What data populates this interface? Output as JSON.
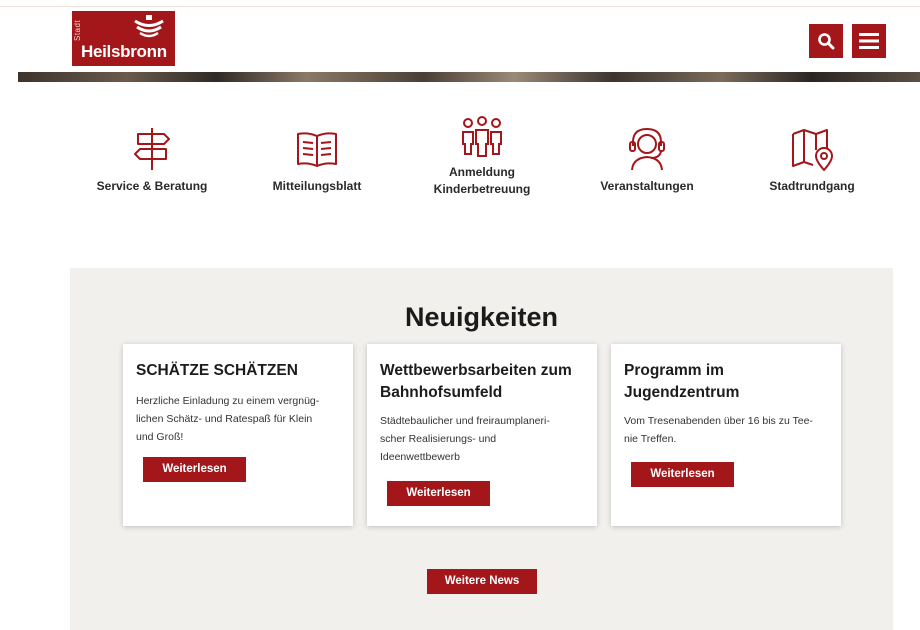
{
  "brand": {
    "prefix": "Stadt",
    "name": "Heilsbronn",
    "color": "#a3171b"
  },
  "header": {
    "search_icon": "search-icon",
    "menu_icon": "hamburger-menu-icon"
  },
  "quick_links": [
    {
      "label": "Service & Beratung",
      "icon": "signpost-icon"
    },
    {
      "label": "Mitteilungsblatt",
      "icon": "open-book-icon"
    },
    {
      "label_line1": "Anmeldung",
      "label_line2": "Kinderbetreuung",
      "icon": "family-icon"
    },
    {
      "label": "Veranstaltungen",
      "icon": "headset-person-icon"
    },
    {
      "label": "Stadtrundgang",
      "icon": "map-pin-icon"
    }
  ],
  "news": {
    "heading": "Neuigkeiten",
    "cards": [
      {
        "title": "SCHÄTZE SCHÄTZEN",
        "text_lines": [
          "Herzliche Einladung zu einem vergnüg-",
          "lichen Schätz- und Ratespaß für Klein",
          "und Groß!"
        ],
        "button": "Weiterlesen"
      },
      {
        "title_line1": "Wettbewerbsarbeiten zum",
        "title_line2": "Bahnhofsumfeld",
        "text_lines": [
          "Städtebaulicher und freiraumplaneri-",
          "scher Realisierungs- und",
          "Ideenwettbewerb"
        ],
        "button": "Weiterlesen"
      },
      {
        "title_line1": "Programm im",
        "title_line2": "Jugendzentrum",
        "text_lines": [
          "Vom Tresenabenden über 16 bis zu Tee-",
          "nie Treffen."
        ],
        "button": "Weiterlesen"
      }
    ],
    "more_button": "Weitere News"
  }
}
